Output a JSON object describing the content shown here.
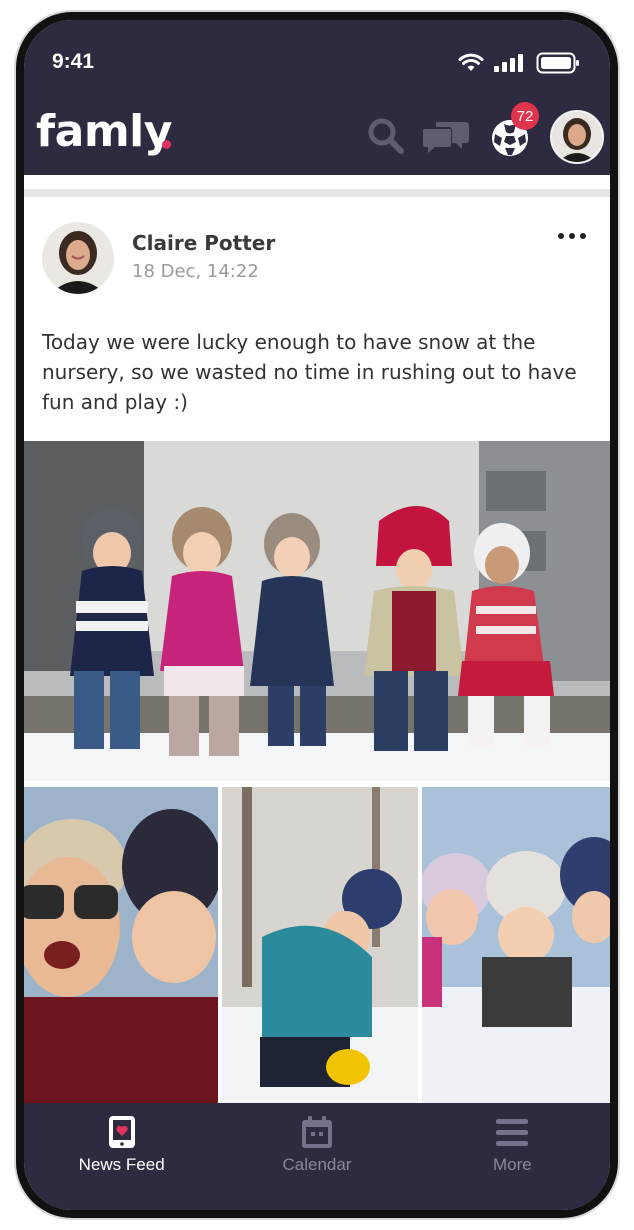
{
  "status_bar": {
    "time": "9:41"
  },
  "header": {
    "logo": "famly",
    "icons": [
      "search-icon",
      "messages-icon",
      "notifications-icon"
    ],
    "notification_count": "72"
  },
  "post": {
    "author": "Claire Potter",
    "date": "18 Dec, 14:22",
    "text": "Today we were lucky enough to have snow at the nursery, so we wasted no time in rushing out to have fun and play :)"
  },
  "tabs": [
    {
      "label": "News Feed",
      "icon": "newsfeed-icon",
      "active": true
    },
    {
      "label": "Calendar",
      "icon": "calendar-icon",
      "active": false
    },
    {
      "label": "More",
      "icon": "menu-icon",
      "active": false
    }
  ],
  "colors": {
    "brand_dark": "#2e2b40",
    "badge": "#e0334d",
    "accent": "#e0325e"
  }
}
